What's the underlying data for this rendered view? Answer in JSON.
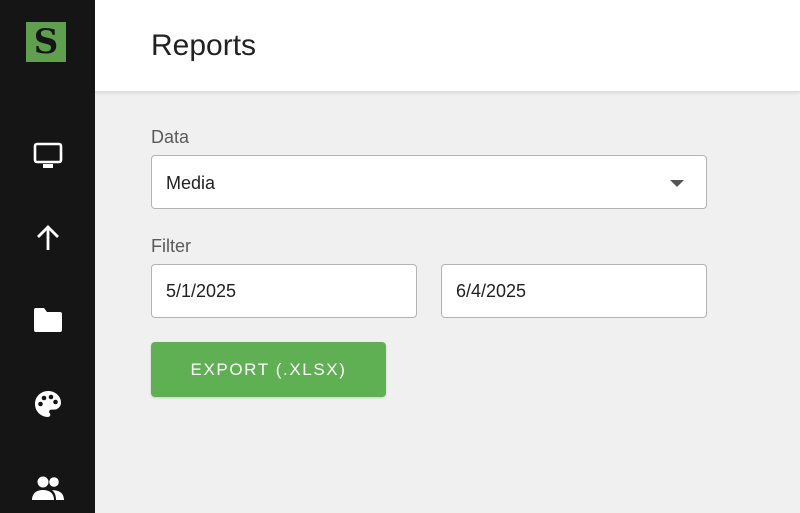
{
  "app": {
    "logo_letter": "S",
    "accent_color": "#5fa04e"
  },
  "sidebar": {
    "items": [
      {
        "icon": "monitor-icon"
      },
      {
        "icon": "upload-arrow-icon"
      },
      {
        "icon": "folder-icon"
      },
      {
        "icon": "palette-icon"
      },
      {
        "icon": "users-icon"
      }
    ]
  },
  "header": {
    "title": "Reports"
  },
  "form": {
    "data_label": "Data",
    "data_value": "Media",
    "filter_label": "Filter",
    "start_date": "5/1/2025",
    "end_date": "6/4/2025",
    "export_label": "EXPORT (.XLSX)"
  }
}
